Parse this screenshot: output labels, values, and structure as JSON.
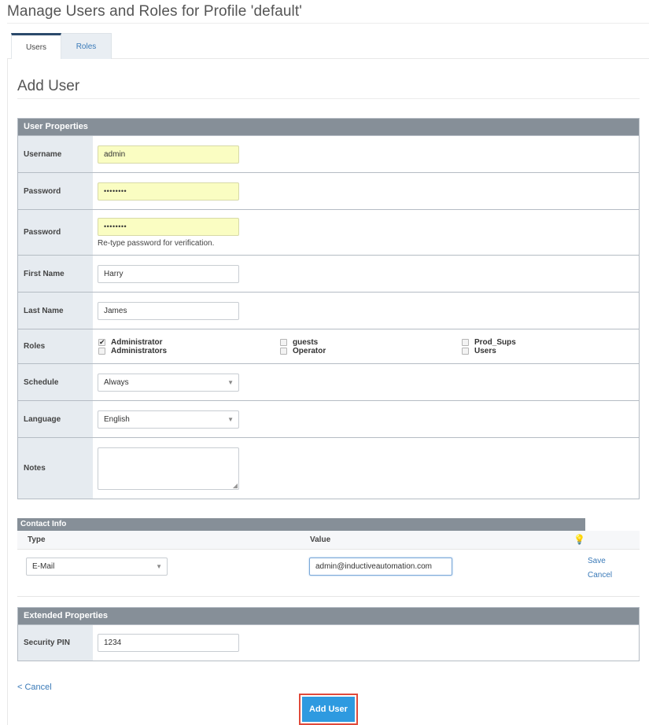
{
  "page": {
    "title": "Manage Users and Roles for Profile 'default'"
  },
  "tabs": [
    {
      "label": "Users",
      "active": true
    },
    {
      "label": "Roles",
      "active": false
    }
  ],
  "section": {
    "title": "Add User"
  },
  "user_properties": {
    "header": "User Properties",
    "username": {
      "label": "Username",
      "value": "admin"
    },
    "password": {
      "label": "Password",
      "value": "••••••••"
    },
    "password_confirm": {
      "label": "Password",
      "value": "••••••••",
      "hint": "Re-type password for verification."
    },
    "first_name": {
      "label": "First Name",
      "value": "Harry"
    },
    "last_name": {
      "label": "Last Name",
      "value": "James"
    },
    "roles": {
      "label": "Roles",
      "items": [
        {
          "name": "Administrator",
          "checked": true
        },
        {
          "name": "guests",
          "checked": false
        },
        {
          "name": "Prod_Sups",
          "checked": false
        },
        {
          "name": "Administrators",
          "checked": false
        },
        {
          "name": "Operator",
          "checked": false
        },
        {
          "name": "Users",
          "checked": false
        }
      ]
    },
    "schedule": {
      "label": "Schedule",
      "value": "Always"
    },
    "language": {
      "label": "Language",
      "value": "English"
    },
    "notes": {
      "label": "Notes",
      "value": ""
    }
  },
  "contact_info": {
    "header": "Contact Info",
    "col_type": "Type",
    "col_value": "Value",
    "row": {
      "type": "E-Mail",
      "value": "admin@inductiveautomation.com",
      "save": "Save",
      "cancel": "Cancel"
    }
  },
  "extended_properties": {
    "header": "Extended Properties",
    "security_pin": {
      "label": "Security PIN",
      "value": "1234"
    }
  },
  "actions": {
    "cancel": "< Cancel",
    "submit": "Add User"
  },
  "colors": {
    "header_bg": "#868f98",
    "label_bg": "#e6ebf0",
    "link": "#3a7ab8",
    "button": "#2e9ae0",
    "highlight_outline": "#e0493a",
    "autofill": "#fafdc2"
  }
}
